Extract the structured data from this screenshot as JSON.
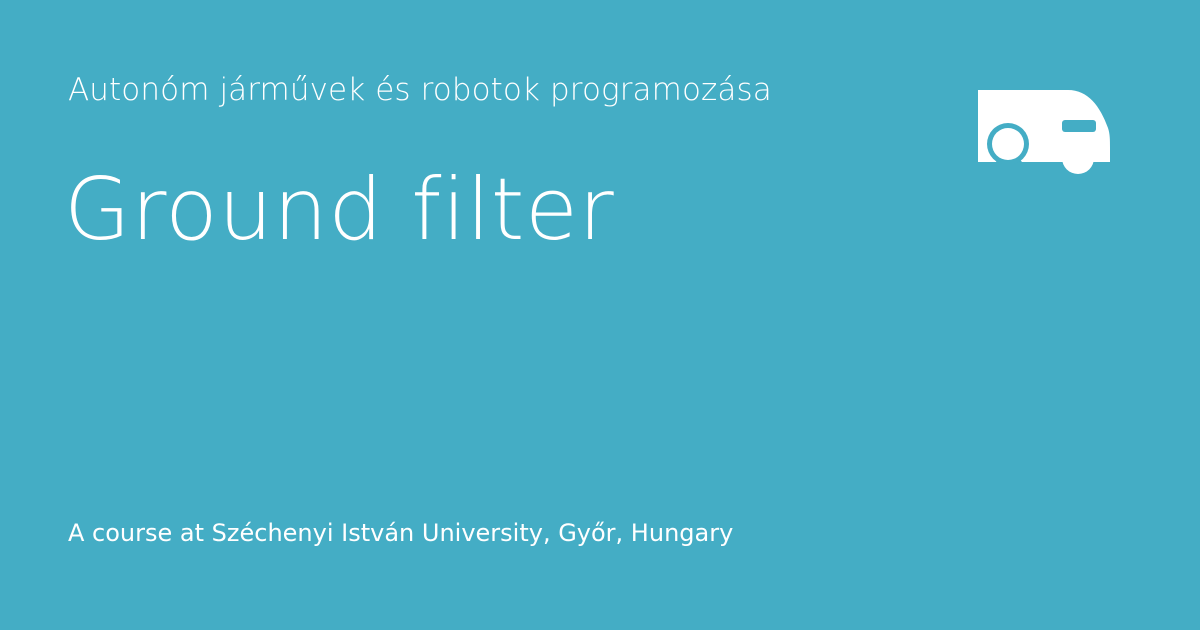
{
  "header": {
    "course_title": "Autonóm járművek és robotok programozása"
  },
  "main": {
    "title": "Ground filter"
  },
  "footer": {
    "text": "A course at Széchenyi István University, Győr, Hungary"
  },
  "logo": {
    "icon": "vehicle-icon",
    "color": "#ffffff"
  },
  "theme": {
    "background": "#44adc5",
    "text_color": "#ffffff"
  }
}
